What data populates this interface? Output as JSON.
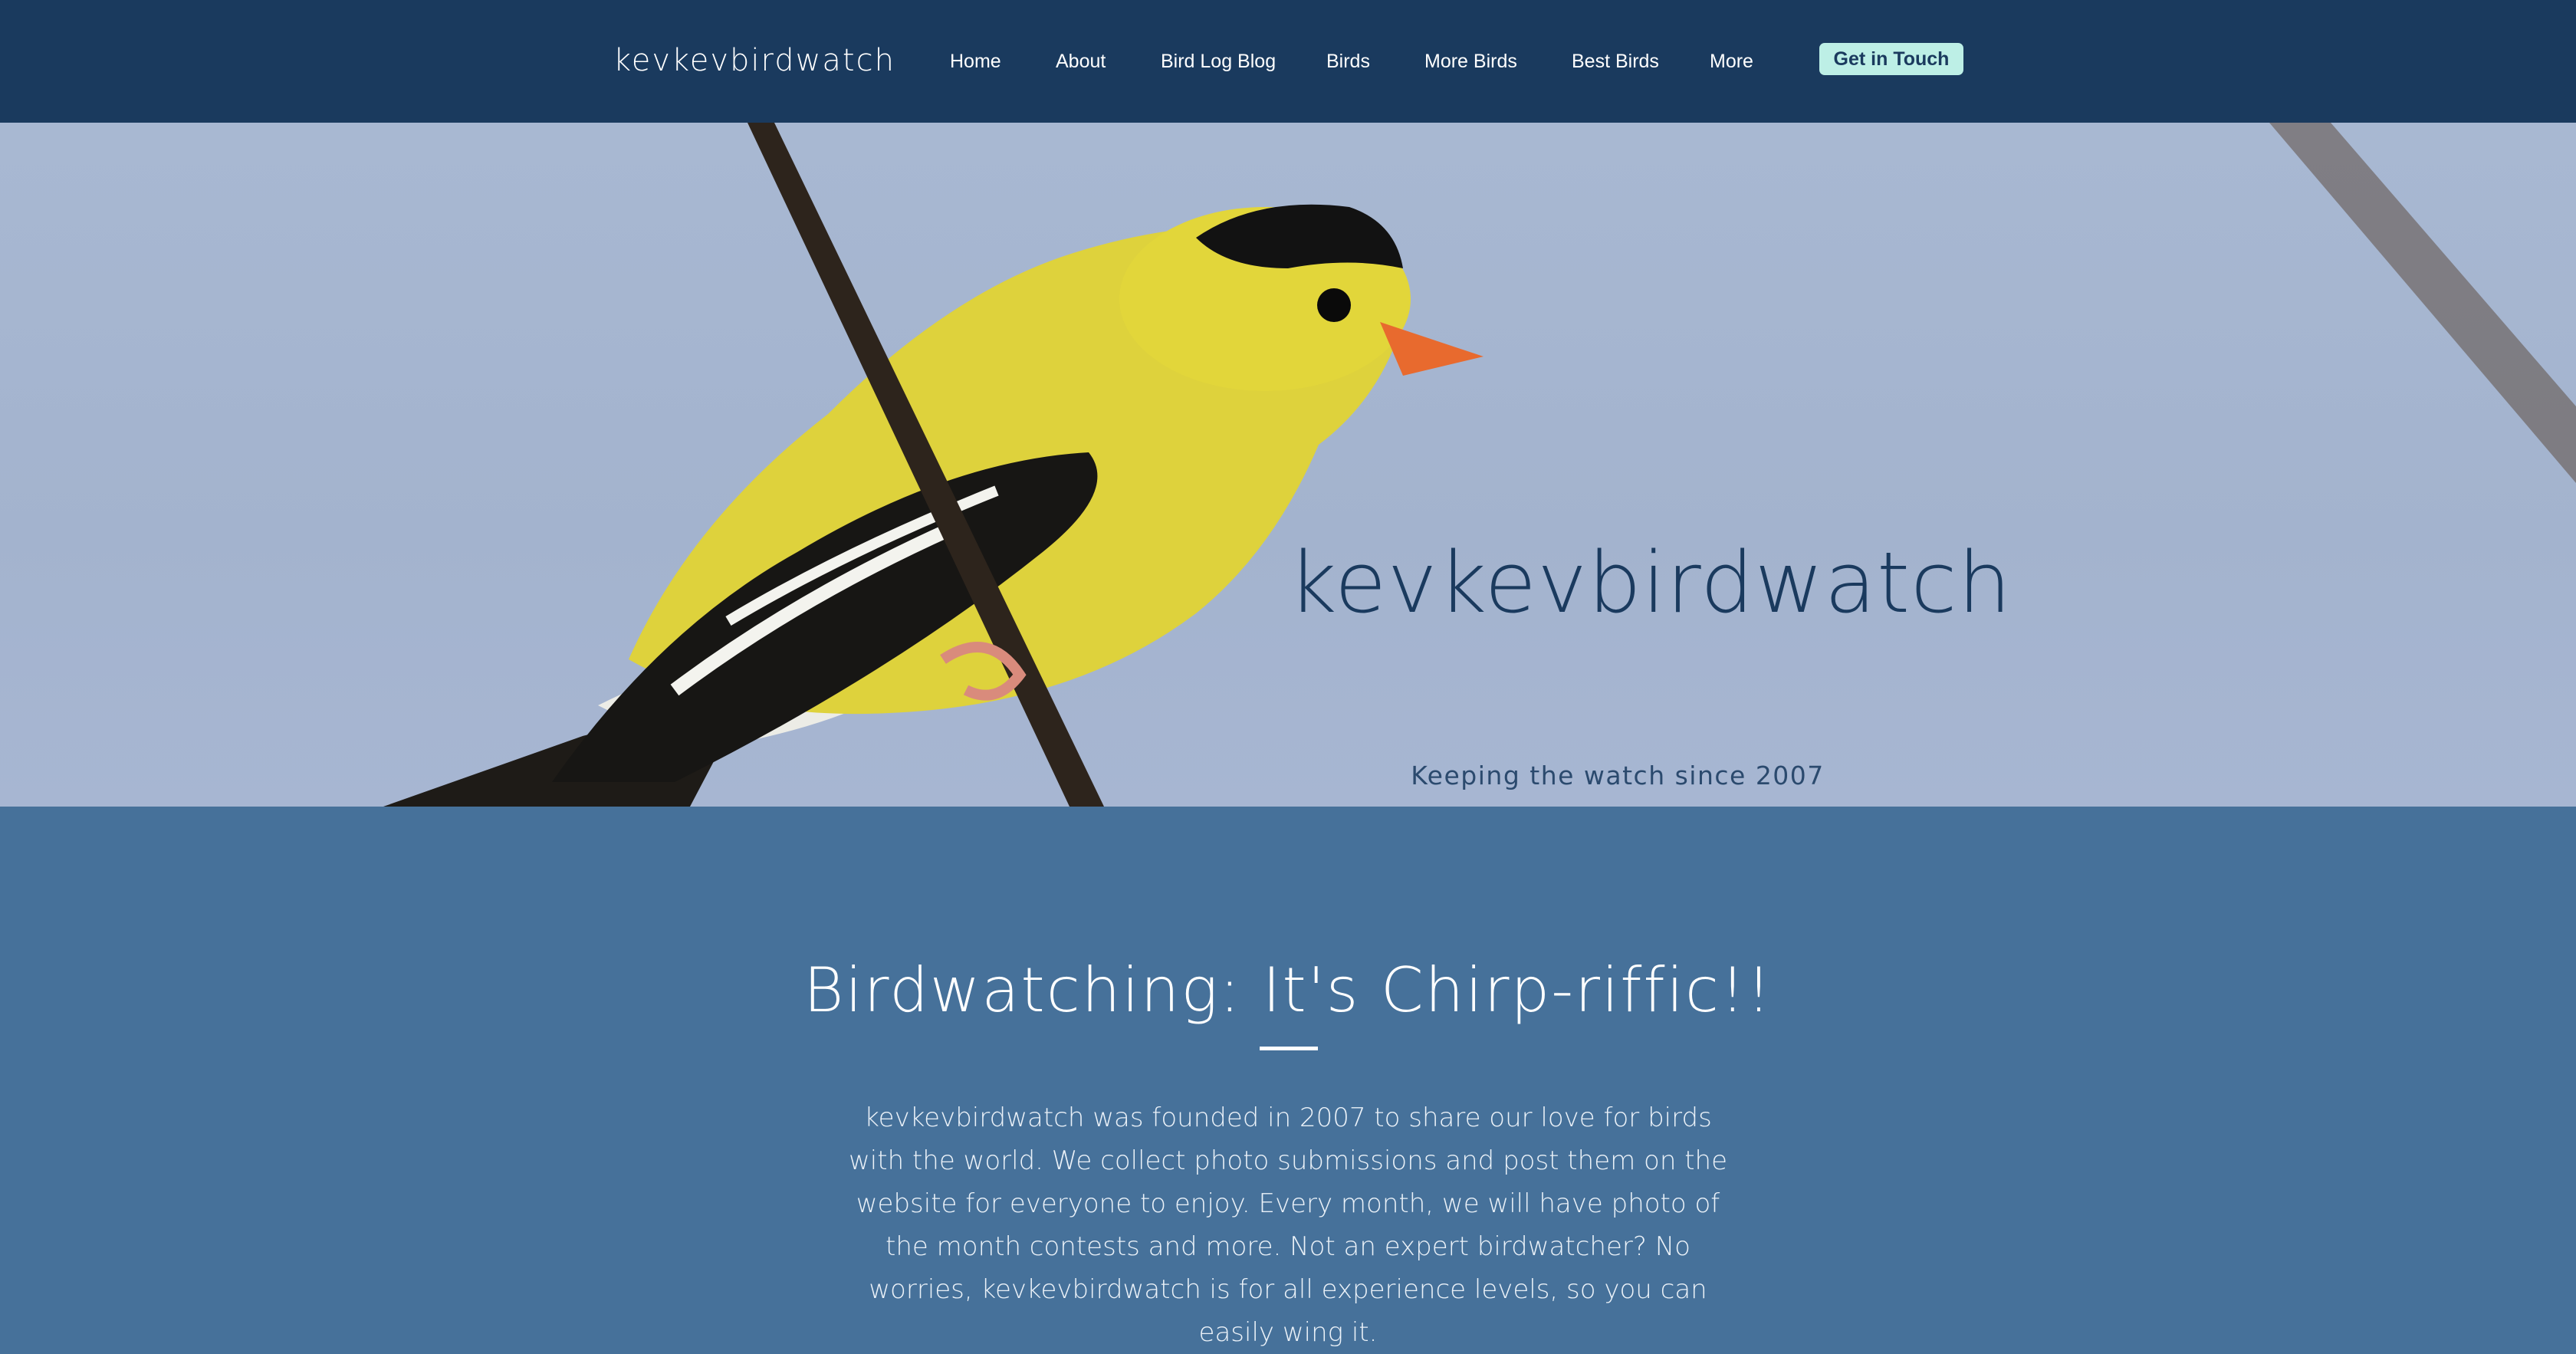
{
  "header": {
    "brand": "kevkevbirdwatch",
    "nav": [
      {
        "label": "Home"
      },
      {
        "label": "About"
      },
      {
        "label": "Bird Log Blog"
      },
      {
        "label": "Birds"
      },
      {
        "label": "More Birds"
      },
      {
        "label": "Best Birds"
      },
      {
        "label": "More"
      }
    ],
    "cta_label": "Get in Touch"
  },
  "hero": {
    "title": "kevkevbirdwatch",
    "subtitle": "Keeping the watch since 2007",
    "image_subject": "american-goldfinch-on-branch"
  },
  "about": {
    "heading": "Birdwatching: It's Chirp-riffic!!",
    "body": "kevkevbirdwatch was founded in 2007 to share our love for birds with the world. We collect photo submissions and post them on the website for everyone to enjoy. Every month, we will have photo of the month contests and more. Not an expert birdwatcher? No worries, kevkevbirdwatch is for all experience levels, so you can easily wing it."
  },
  "colors": {
    "header_bg": "#1A3A5E",
    "section_bg": "#46719A",
    "cta_bg": "#BDEFE6",
    "sky": "#A8B8D2",
    "bird_yellow": "#E2D63A"
  }
}
